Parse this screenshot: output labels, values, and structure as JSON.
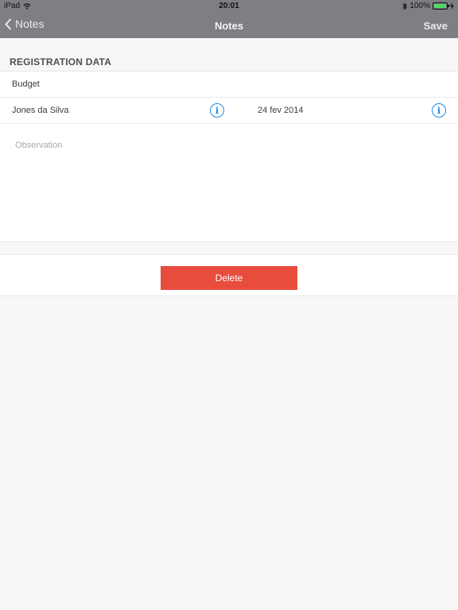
{
  "status_bar": {
    "device": "iPad",
    "time": "20:01",
    "battery": "100%",
    "battery_level": 1.0
  },
  "nav": {
    "back_label": "Notes",
    "title": "Notes",
    "save_label": "Save"
  },
  "section": {
    "title": "REGISTRATION DATA"
  },
  "form": {
    "budget_label": "Budget",
    "person_name": "Jones da Silva",
    "date": "24 fev 2014",
    "observation_placeholder": "Observation",
    "info_icon_glyph": "i"
  },
  "actions": {
    "delete_label": "Delete"
  },
  "colors": {
    "header_bg": "#7d7f83",
    "accent_blue": "#1e88e5",
    "delete_red": "#e84c3d",
    "battery_green": "#4cd964"
  }
}
